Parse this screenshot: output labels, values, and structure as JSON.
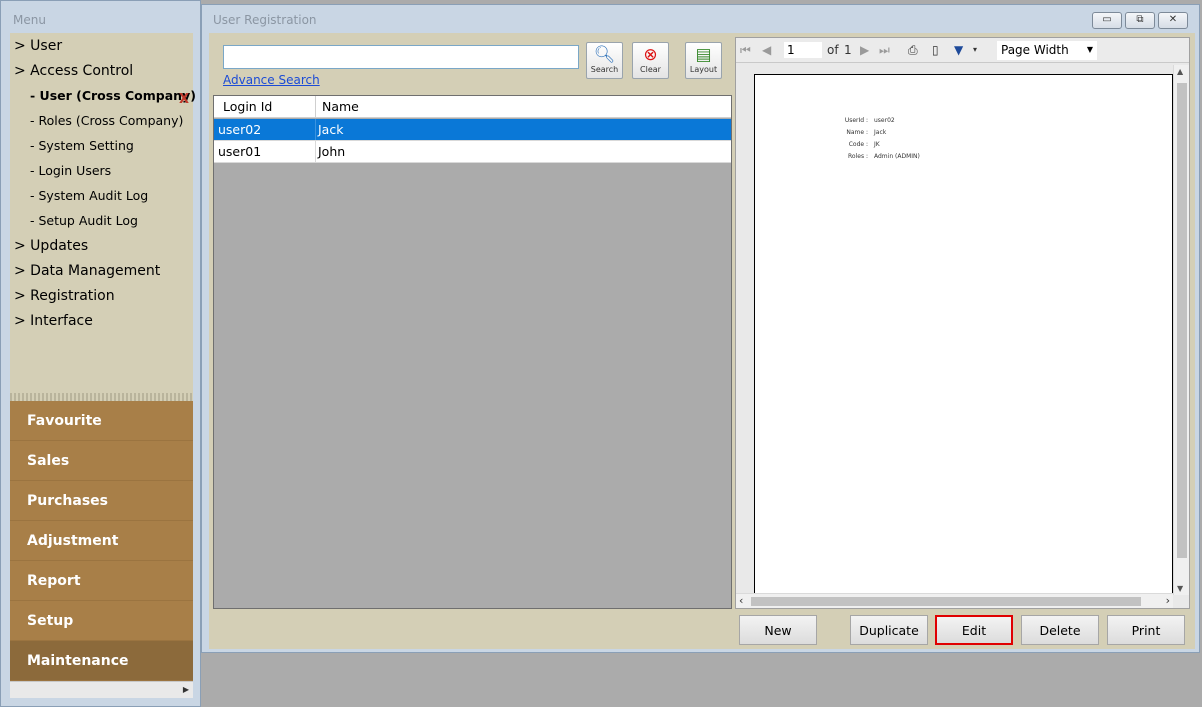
{
  "menu": {
    "title": "Menu",
    "tree": [
      {
        "label": "> User",
        "level": 0
      },
      {
        "label": "> Access Control",
        "level": 0
      },
      {
        "label": "- User (Cross Company)",
        "level": 1,
        "active": true
      },
      {
        "label": "- Roles (Cross Company)",
        "level": 1
      },
      {
        "label": "- System Setting",
        "level": 1
      },
      {
        "label": "- Login Users",
        "level": 1
      },
      {
        "label": "- System Audit Log",
        "level": 1
      },
      {
        "label": "- Setup Audit Log",
        "level": 1
      },
      {
        "label": "> Updates",
        "level": 0
      },
      {
        "label": "> Data Management",
        "level": 0
      },
      {
        "label": "> Registration",
        "level": 0
      },
      {
        "label": "> Interface",
        "level": 0
      }
    ],
    "close_mark": "X",
    "modules": [
      "Favourite",
      "Sales",
      "Purchases",
      "Adjustment",
      "Report",
      "Setup",
      "Maintenance"
    ],
    "active_module": "Maintenance"
  },
  "window": {
    "title": "User Registration",
    "minimize_glyph": "▭",
    "restore_glyph": "⧉",
    "close_glyph": "✕"
  },
  "search": {
    "value": "",
    "placeholder": "",
    "advance_link": "Advance Search",
    "buttons": {
      "search": "Search",
      "clear": "Clear",
      "layout": "Layout"
    }
  },
  "grid": {
    "columns": [
      "Login Id",
      "Name"
    ],
    "rows": [
      {
        "login_id": "user02",
        "name": "Jack",
        "selected": true
      },
      {
        "login_id": "user01",
        "name": "John",
        "selected": false
      }
    ]
  },
  "viewer": {
    "page": "1",
    "of_label": "of",
    "total_pages": "1",
    "zoom": "Page Width",
    "report": {
      "fields": [
        {
          "label": "UserId :",
          "value": "user02"
        },
        {
          "label": "Name :",
          "value": "Jack"
        },
        {
          "label": "Code :",
          "value": "JK"
        },
        {
          "label": "Roles :",
          "value": "Admin (ADMIN)"
        }
      ]
    }
  },
  "actions": {
    "new": "New",
    "duplicate": "Duplicate",
    "edit": "Edit",
    "delete": "Delete",
    "print": "Print"
  },
  "colors": {
    "selected_row": "#0a78d7",
    "module_bg": "#a87f48",
    "module_active_bg": "#8c6a3b",
    "highlight_border": "#e00000"
  }
}
